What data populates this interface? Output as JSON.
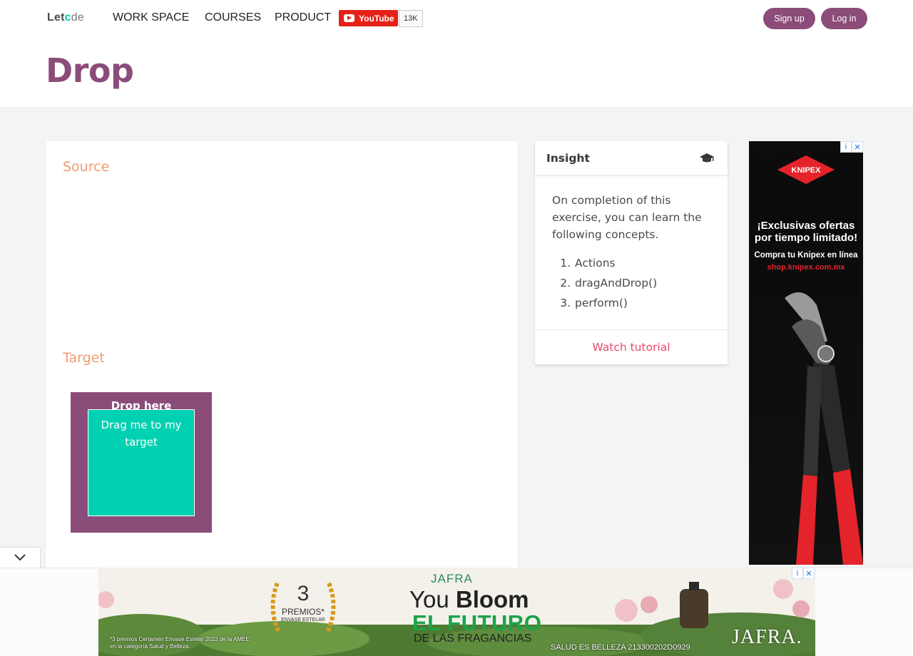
{
  "header": {
    "logo_let": "Let",
    "logo_c": "c",
    "logo_rest": "de",
    "nav": [
      "WORK SPACE",
      "COURSES",
      "PRODUCT"
    ],
    "youtube_label": "YouTube",
    "youtube_count": "13K",
    "signup": "Sign up",
    "login": "Log in"
  },
  "page": {
    "title": "Drop"
  },
  "main": {
    "source_label": "Source",
    "target_label": "Target",
    "drop_zone_text": "Drop here",
    "draggable_text": "Drag me to my target"
  },
  "insight": {
    "title": "Insight",
    "intro": "On completion of this exercise, you can learn the following concepts.",
    "concepts": [
      "Actions",
      "dragAndDrop()",
      "perform()"
    ],
    "watch_tutorial": "Watch tutorial"
  },
  "side_ad": {
    "brand": "KNIPEX",
    "headline_1": "¡Exclusivas ofertas",
    "headline_2": "por tiempo limitado!",
    "sub": "Compra tu Knipex en línea",
    "url": "shop.knipex.com.mx"
  },
  "bottom_ad": {
    "award_num": "3",
    "award_text": "PREMIOS*",
    "award_sub": "ENVASE ESTELAR",
    "fine_print": "*3 premios Certamen Envase Estelar 2022 de la AMEE en la categoría Salud y Belleza.",
    "jafra_top": "JAFRA",
    "you": "You ",
    "bloom": "Bloom",
    "el_futuro": "EL FUTURO",
    "fragancias": "DE LAS FRAGANCIAS",
    "salud": "SALUD ES BELLEZA 213300202D0929",
    "brand": "JAFRA."
  },
  "colors": {
    "brand": "#8b4c79",
    "accent_teal": "#00d1b2",
    "label_orange": "#f19b6d",
    "link_red": "#f14668"
  }
}
